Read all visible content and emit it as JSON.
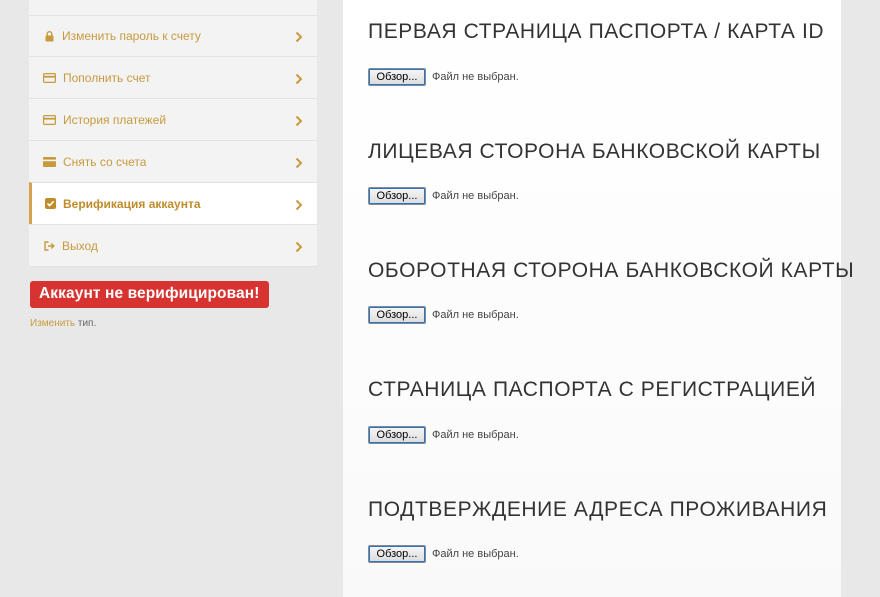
{
  "sidebar": {
    "menu": [
      {
        "label": "",
        "icon": "menu-top-edge"
      },
      {
        "label": "Изменить пароль к счету",
        "icon": "lock-icon"
      },
      {
        "label": "Пополнить счет",
        "icon": "credit-card-icon"
      },
      {
        "label": "История платежей",
        "icon": "credit-card-icon"
      },
      {
        "label": "Снять со счета",
        "icon": "credit-card-filled-icon"
      },
      {
        "label": "Верификация аккаунта",
        "icon": "check-square-icon",
        "active": true
      },
      {
        "label": "Выход",
        "icon": "sign-out-icon"
      }
    ],
    "status_badge": "Аккаунт не верифицирован!",
    "change_type": {
      "link": "Изменить",
      "suffix": " тип."
    }
  },
  "main": {
    "sections": [
      {
        "title": "ПЕРВАЯ СТРАНИЦА ПАСПОРТА / КАРТА ID",
        "button": "Обзор...",
        "status": "Файл не выбран."
      },
      {
        "title": "ЛИЦЕВАЯ СТОРОНА БАНКОВСКОЙ КАРТЫ",
        "button": "Обзор...",
        "status": "Файл не выбран."
      },
      {
        "title": "ОБОРОТНАЯ СТОРОНА БАНКОВСКОЙ КАРТЫ",
        "button": "Обзор...",
        "status": "Файл не выбран."
      },
      {
        "title": "СТРАНИЦА ПАСПОРТА С РЕГИСТРАЦИЕЙ",
        "button": "Обзор...",
        "status": "Файл не выбран."
      },
      {
        "title": "ПОДТВЕРЖДЕНИЕ АДРЕСА ПРОЖИВАНИЯ",
        "button": "Обзор...",
        "status": "Файл не выбран."
      }
    ]
  },
  "colors": {
    "accent": "#c89a3e",
    "danger": "#d63331",
    "page_bg": "#e8e8e8"
  }
}
